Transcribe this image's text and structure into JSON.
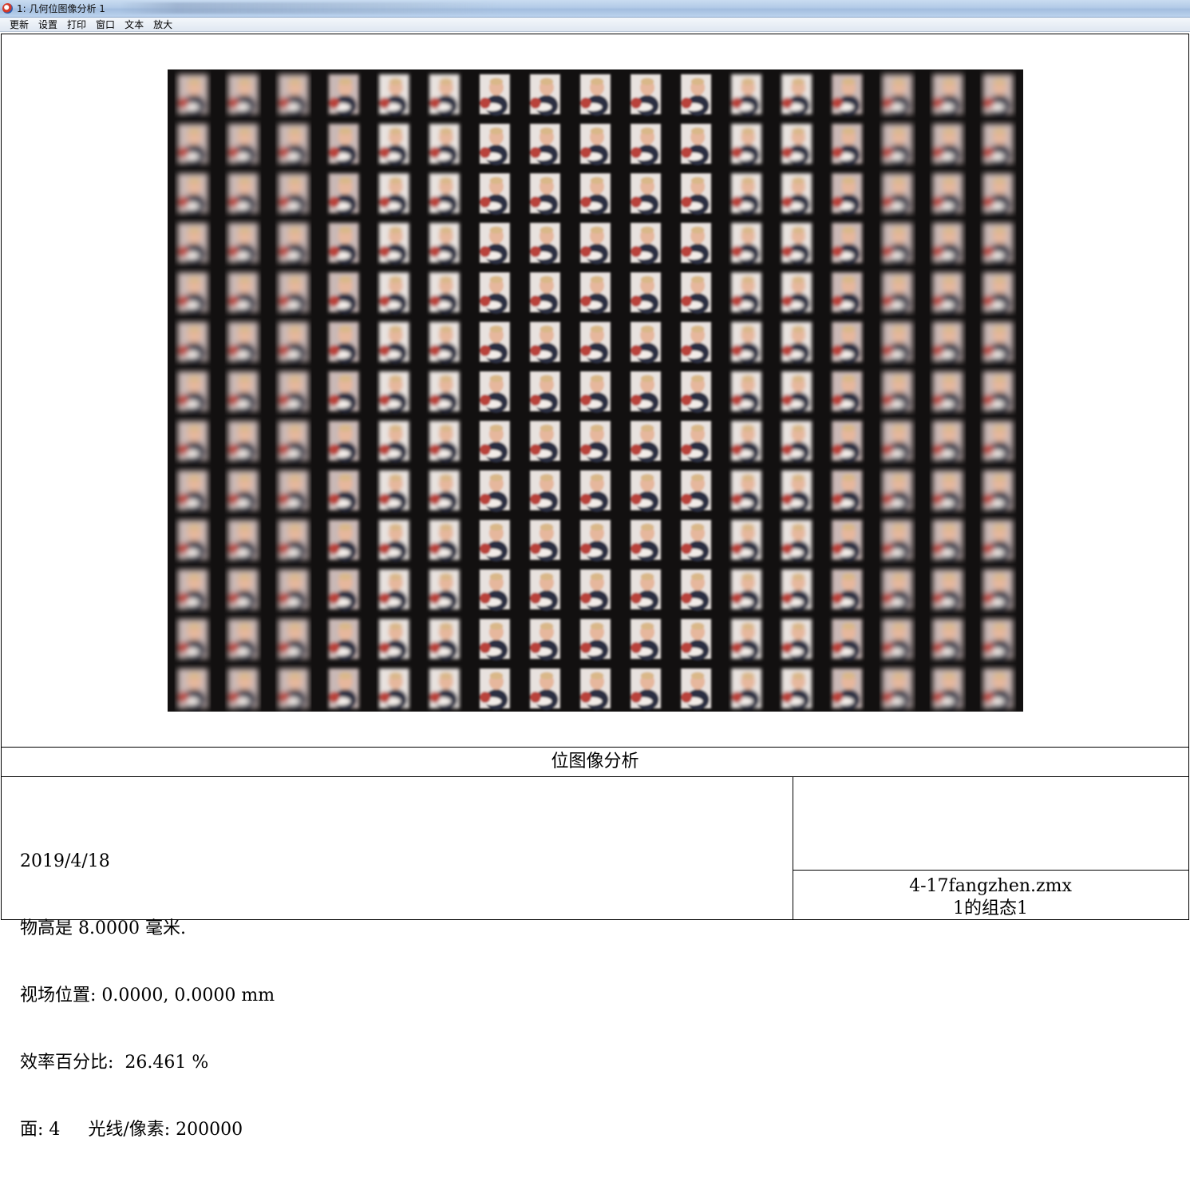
{
  "window": {
    "title": "1: 几何位图像分析 1"
  },
  "menu": [
    "更新",
    "设置",
    "打印",
    "窗口",
    "文本",
    "放大"
  ],
  "plot": {
    "title": "位图像分析",
    "grid_columns": 17,
    "grid_rows": 13
  },
  "info": {
    "date": "2019/4/18",
    "object_height": "物高是 8.0000 毫米.",
    "field_position": "视场位置: 0.0000, 0.0000 mm",
    "efficiency": "效率百分比:  26.461 %",
    "surface_rays": "面: 4     光线/像素: 200000"
  },
  "file": {
    "name": "4-17fangzhen.zmx",
    "config": "1的组态1"
  }
}
